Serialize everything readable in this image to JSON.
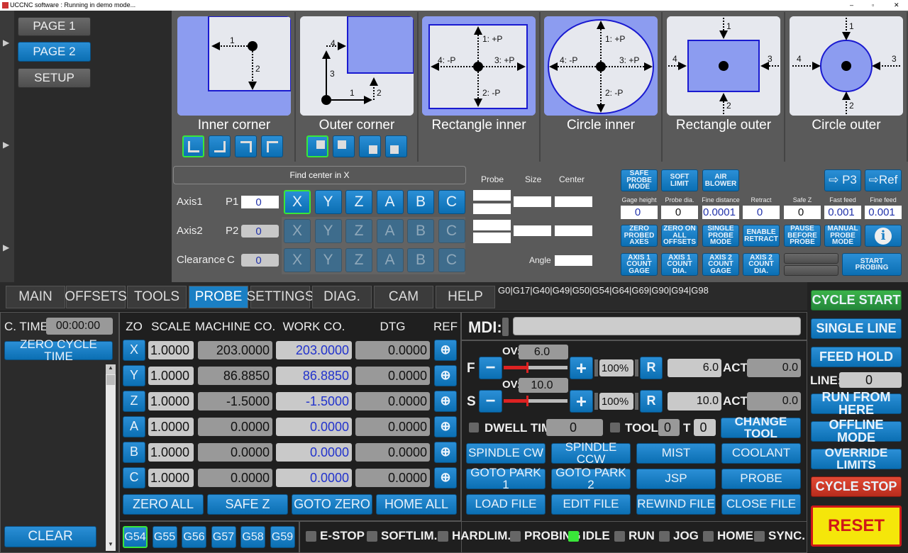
{
  "window": {
    "title": "UCCNC software : Running in demo mode..."
  },
  "pages": [
    "PAGE 1",
    "PAGE 2",
    "SETUP"
  ],
  "probe_tiles": [
    {
      "label": "Inner corner",
      "marks": [
        "1",
        "2"
      ]
    },
    {
      "label": "Outer corner",
      "marks": [
        "4",
        "3",
        "1",
        "2"
      ]
    },
    {
      "label": "Rectangle inner",
      "marks": [
        "1: +P",
        "4: -P",
        "3: +P",
        "2: -P"
      ]
    },
    {
      "label": "Circle inner",
      "marks": [
        "1: +P",
        "4: -P",
        "3: +P",
        "2: -P"
      ]
    },
    {
      "label": "Rectangle outer",
      "marks": [
        "1",
        "4",
        "3",
        "2"
      ]
    },
    {
      "label": "Circle outer",
      "marks": [
        "1",
        "4",
        "3",
        "2"
      ]
    }
  ],
  "find_center": "Find center in X",
  "axis_rows": [
    {
      "label": "Axis1",
      "p": "P1",
      "value": "0"
    },
    {
      "label": "Axis2",
      "p": "P2",
      "value": "0"
    },
    {
      "label": "Clearance",
      "p": "C",
      "value": "0"
    }
  ],
  "axis_letters": [
    "X",
    "Y",
    "Z",
    "A",
    "B",
    "C"
  ],
  "result_headers": {
    "probe": "Probe",
    "size": "Size",
    "center": "Center",
    "angle": "Angle"
  },
  "probe_buttons_top": [
    "SAFE PROBE MODE",
    "SOFT LIMIT",
    "AIR BLOWER"
  ],
  "goto_p3": "P3",
  "goto_ref": "Ref",
  "params": [
    {
      "label": "Gage height",
      "value": "0"
    },
    {
      "label": "Probe dia.",
      "value": "0"
    },
    {
      "label": "Fine distance",
      "value": "0.0001"
    },
    {
      "label": "Retract",
      "value": "0"
    },
    {
      "label": "Safe Z",
      "value": "0"
    },
    {
      "label": "Fast feed",
      "value": "0.001"
    },
    {
      "label": "Fine feed",
      "value": "0.001"
    }
  ],
  "probe_buttons_mid": [
    "ZERO PROBED AXES",
    "ZERO ON ALL OFFSETS",
    "SINGLE PROBE MODE",
    "ENABLE RETRACT",
    "PAUSE BEFORE PROBE",
    "MANUAL PROBE MODE"
  ],
  "probe_buttons_bot": [
    "AXIS 1 COUNT GAGE",
    "AXIS 1 COUNT DIA.",
    "AXIS 2 COUNT GAGE",
    "AXIS 2 COUNT DIA."
  ],
  "start_probing": "START PROBING",
  "tabs": [
    "MAIN",
    "OFFSETS",
    "TOOLS",
    "PROBE",
    "SETTINGS",
    "DIAG.",
    "CAM",
    "HELP"
  ],
  "active_tab": "PROBE",
  "gcodes": "G0|G17|G40|G49|G50|G54|G64|G69|G90|G94|G98",
  "cycle_time": {
    "label": "C. TIME:",
    "value": "00:00:00",
    "zero": "ZERO CYCLE TIME"
  },
  "clear": "CLEAR",
  "coord_headers": [
    "ZO",
    "SCALE",
    "MACHINE CO.",
    "WORK CO.",
    "DTG",
    "REF"
  ],
  "coords": [
    {
      "axis": "X",
      "scale": "1.0000",
      "machine": "203.0000",
      "work": "203.0000",
      "dtg": "0.0000"
    },
    {
      "axis": "Y",
      "scale": "1.0000",
      "machine": "86.8850",
      "work": "86.8850",
      "dtg": "0.0000"
    },
    {
      "axis": "Z",
      "scale": "1.0000",
      "machine": "-1.5000",
      "work": "-1.5000",
      "dtg": "0.0000"
    },
    {
      "axis": "A",
      "scale": "1.0000",
      "machine": "0.0000",
      "work": "0.0000",
      "dtg": "0.0000"
    },
    {
      "axis": "B",
      "scale": "1.0000",
      "machine": "0.0000",
      "work": "0.0000",
      "dtg": "0.0000"
    },
    {
      "axis": "C",
      "scale": "1.0000",
      "machine": "0.0000",
      "work": "0.0000",
      "dtg": "0.0000"
    }
  ],
  "coord_buttons": [
    "ZERO ALL",
    "SAFE Z",
    "GOTO ZERO",
    "HOME ALL"
  ],
  "work_offsets": [
    "G54",
    "G55",
    "G56",
    "G57",
    "G58",
    "G59"
  ],
  "active_offset": "G54",
  "mdi": {
    "label": "MDI:",
    "value": ""
  },
  "feed": {
    "label": "F",
    "ov_label": "OV:",
    "ov": "6.0",
    "percent": "100%",
    "override_fraction": 0.35,
    "reset": "R",
    "set": "6.0",
    "act_label": "ACT:",
    "act": "0.0"
  },
  "spindle": {
    "label": "S",
    "ov_label": "OV:",
    "ov": "10.0",
    "percent": "100%",
    "override_fraction": 0.35,
    "reset": "R",
    "set": "10.0",
    "act_label": "ACT:",
    "act": "0.0"
  },
  "dwell": {
    "label": "DWELL TIME:",
    "value": "0"
  },
  "tool": {
    "label": "TOOL:",
    "value": "0",
    "t_label": "T",
    "t_value": "0",
    "change": "CHANGE TOOL"
  },
  "func_buttons": [
    "SPINDLE CW",
    "SPINDLE CCW",
    "MIST",
    "COOLANT",
    "GOTO PARK 1",
    "GOTO PARK 2",
    "JSP",
    "PROBE",
    "LOAD FILE",
    "EDIT FILE",
    "REWIND FILE",
    "CLOSE FILE"
  ],
  "status": [
    {
      "label": "E-STOP",
      "on": false
    },
    {
      "label": "SOFTLIM.",
      "on": false
    },
    {
      "label": "HARDLIM.",
      "on": false
    },
    {
      "label": "PROBING",
      "on": false
    },
    {
      "label": "IDLE",
      "on": true
    },
    {
      "label": "RUN",
      "on": false
    },
    {
      "label": "JOG",
      "on": false
    },
    {
      "label": "HOME",
      "on": false
    },
    {
      "label": "SYNC.",
      "on": false
    }
  ],
  "right": {
    "cycle_start": "CYCLE START",
    "single_line": "SINGLE LINE",
    "feed_hold": "FEED HOLD",
    "line_label": "LINE:",
    "line": "0",
    "run_from_here": "RUN FROM HERE",
    "offline_mode": "OFFLINE MODE",
    "override_limits": "OVERRIDE LIMITS",
    "cycle_stop": "CYCLE STOP",
    "reset": "RESET"
  },
  "colors": {
    "button_blue": "#1a7fc4",
    "probe_fill": "#8c9cf0",
    "cycle_start": "#2e9e3e",
    "cycle_stop": "#d03a2a",
    "reset": "#f5e60a",
    "led_on": "#39e639"
  }
}
